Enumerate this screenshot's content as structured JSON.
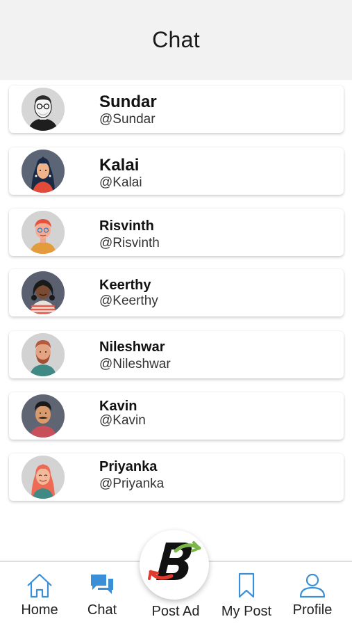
{
  "header": {
    "title": "Chat"
  },
  "contacts": [
    {
      "name": "Sundar",
      "handle": "@Sundar"
    },
    {
      "name": "Kalai",
      "handle": "@Kalai"
    },
    {
      "name": "Risvinth",
      "handle": "@Risvinth"
    },
    {
      "name": "Keerthy",
      "handle": "@Keerthy"
    },
    {
      "name": "Nileshwar",
      "handle": "@Nileshwar"
    },
    {
      "name": "Kavin",
      "handle": "@Kavin"
    },
    {
      "name": "Priyanka",
      "handle": "@Priyanka"
    }
  ],
  "bottom_nav": {
    "items": [
      {
        "label": "Home",
        "icon": "home-icon"
      },
      {
        "label": "Chat",
        "icon": "chat-icon"
      },
      {
        "label": "Post Ad",
        "icon": "post-ad-logo"
      },
      {
        "label": "My Post",
        "icon": "bookmark-icon"
      },
      {
        "label": "Profile",
        "icon": "profile-icon"
      }
    ]
  },
  "colors": {
    "accent": "#3b8fd6",
    "header_bg": "#f2f2f2",
    "logo_red": "#e03a2f",
    "logo_green": "#7ab648"
  }
}
